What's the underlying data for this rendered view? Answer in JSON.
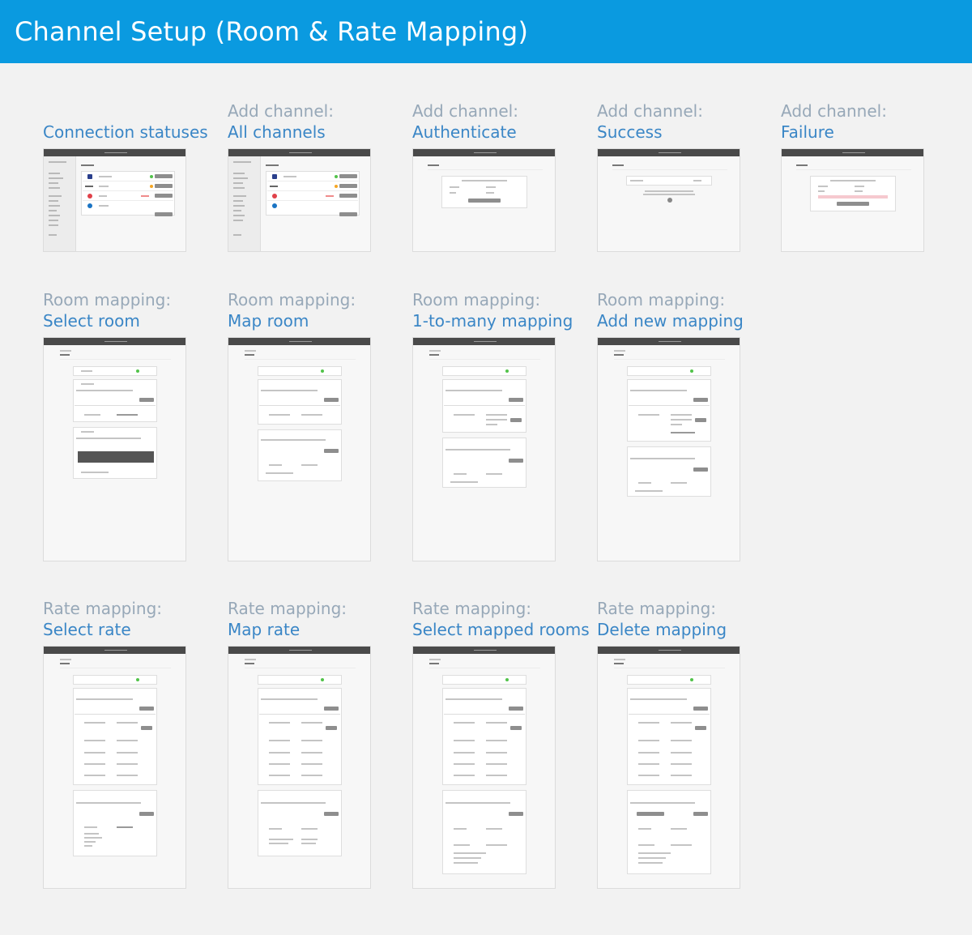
{
  "page": {
    "title": "Channel Setup (Room & Rate Mapping)"
  },
  "screens": [
    {
      "id": "connection-statuses",
      "line1": "",
      "line2": "Connection statuses"
    },
    {
      "id": "add-all",
      "line1": "Add channel:",
      "line2": "All channels"
    },
    {
      "id": "add-auth",
      "line1": "Add channel:",
      "line2": "Authenticate"
    },
    {
      "id": "add-success",
      "line1": "Add channel:",
      "line2": "Success"
    },
    {
      "id": "add-failure",
      "line1": "Add channel:",
      "line2": "Failure"
    },
    {
      "id": "room-select",
      "line1": "Room mapping:",
      "line2": "Select room"
    },
    {
      "id": "room-map",
      "line1": "Room mapping:",
      "line2": "Map room"
    },
    {
      "id": "room-1tomany",
      "line1": "Room mapping:",
      "line2": "1-to-many mapping"
    },
    {
      "id": "room-add",
      "line1": "Room mapping:",
      "line2": "Add new mapping"
    },
    {
      "id": "rate-select",
      "line1": "Rate mapping:",
      "line2": "Select rate"
    },
    {
      "id": "rate-map",
      "line1": "Rate mapping:",
      "line2": "Map rate"
    },
    {
      "id": "rate-rooms",
      "line1": "Rate mapping:",
      "line2": "Select mapped rooms"
    },
    {
      "id": "rate-delete",
      "line1": "Rate mapping:",
      "line2": "Delete mapping"
    }
  ],
  "colors": {
    "header": "#0a9ae0",
    "caption_top": "#97a8b8",
    "caption_bottom": "#3a86c6",
    "background": "#f2f2f2"
  }
}
